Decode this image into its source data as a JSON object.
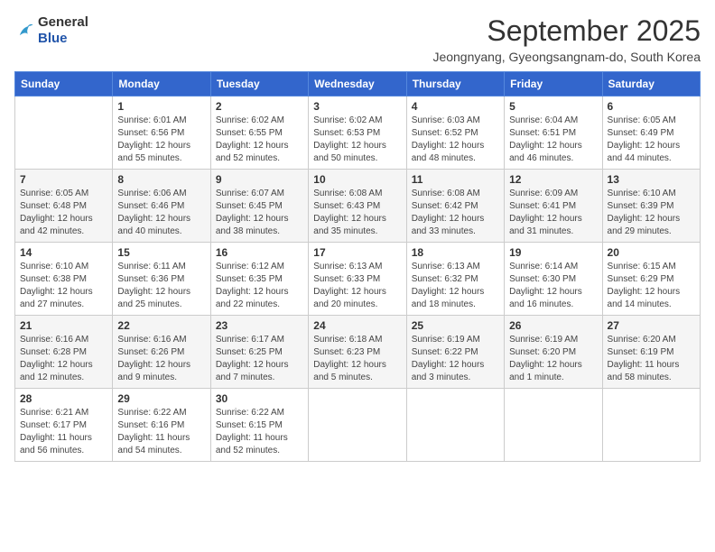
{
  "logo": {
    "general": "General",
    "blue": "Blue"
  },
  "title": "September 2025",
  "subtitle": "Jeongnyang, Gyeongsangnam-do, South Korea",
  "weekdays": [
    "Sunday",
    "Monday",
    "Tuesday",
    "Wednesday",
    "Thursday",
    "Friday",
    "Saturday"
  ],
  "weeks": [
    [
      {
        "day": "",
        "info": ""
      },
      {
        "day": "1",
        "info": "Sunrise: 6:01 AM\nSunset: 6:56 PM\nDaylight: 12 hours\nand 55 minutes."
      },
      {
        "day": "2",
        "info": "Sunrise: 6:02 AM\nSunset: 6:55 PM\nDaylight: 12 hours\nand 52 minutes."
      },
      {
        "day": "3",
        "info": "Sunrise: 6:02 AM\nSunset: 6:53 PM\nDaylight: 12 hours\nand 50 minutes."
      },
      {
        "day": "4",
        "info": "Sunrise: 6:03 AM\nSunset: 6:52 PM\nDaylight: 12 hours\nand 48 minutes."
      },
      {
        "day": "5",
        "info": "Sunrise: 6:04 AM\nSunset: 6:51 PM\nDaylight: 12 hours\nand 46 minutes."
      },
      {
        "day": "6",
        "info": "Sunrise: 6:05 AM\nSunset: 6:49 PM\nDaylight: 12 hours\nand 44 minutes."
      }
    ],
    [
      {
        "day": "7",
        "info": "Sunrise: 6:05 AM\nSunset: 6:48 PM\nDaylight: 12 hours\nand 42 minutes."
      },
      {
        "day": "8",
        "info": "Sunrise: 6:06 AM\nSunset: 6:46 PM\nDaylight: 12 hours\nand 40 minutes."
      },
      {
        "day": "9",
        "info": "Sunrise: 6:07 AM\nSunset: 6:45 PM\nDaylight: 12 hours\nand 38 minutes."
      },
      {
        "day": "10",
        "info": "Sunrise: 6:08 AM\nSunset: 6:43 PM\nDaylight: 12 hours\nand 35 minutes."
      },
      {
        "day": "11",
        "info": "Sunrise: 6:08 AM\nSunset: 6:42 PM\nDaylight: 12 hours\nand 33 minutes."
      },
      {
        "day": "12",
        "info": "Sunrise: 6:09 AM\nSunset: 6:41 PM\nDaylight: 12 hours\nand 31 minutes."
      },
      {
        "day": "13",
        "info": "Sunrise: 6:10 AM\nSunset: 6:39 PM\nDaylight: 12 hours\nand 29 minutes."
      }
    ],
    [
      {
        "day": "14",
        "info": "Sunrise: 6:10 AM\nSunset: 6:38 PM\nDaylight: 12 hours\nand 27 minutes."
      },
      {
        "day": "15",
        "info": "Sunrise: 6:11 AM\nSunset: 6:36 PM\nDaylight: 12 hours\nand 25 minutes."
      },
      {
        "day": "16",
        "info": "Sunrise: 6:12 AM\nSunset: 6:35 PM\nDaylight: 12 hours\nand 22 minutes."
      },
      {
        "day": "17",
        "info": "Sunrise: 6:13 AM\nSunset: 6:33 PM\nDaylight: 12 hours\nand 20 minutes."
      },
      {
        "day": "18",
        "info": "Sunrise: 6:13 AM\nSunset: 6:32 PM\nDaylight: 12 hours\nand 18 minutes."
      },
      {
        "day": "19",
        "info": "Sunrise: 6:14 AM\nSunset: 6:30 PM\nDaylight: 12 hours\nand 16 minutes."
      },
      {
        "day": "20",
        "info": "Sunrise: 6:15 AM\nSunset: 6:29 PM\nDaylight: 12 hours\nand 14 minutes."
      }
    ],
    [
      {
        "day": "21",
        "info": "Sunrise: 6:16 AM\nSunset: 6:28 PM\nDaylight: 12 hours\nand 12 minutes."
      },
      {
        "day": "22",
        "info": "Sunrise: 6:16 AM\nSunset: 6:26 PM\nDaylight: 12 hours\nand 9 minutes."
      },
      {
        "day": "23",
        "info": "Sunrise: 6:17 AM\nSunset: 6:25 PM\nDaylight: 12 hours\nand 7 minutes."
      },
      {
        "day": "24",
        "info": "Sunrise: 6:18 AM\nSunset: 6:23 PM\nDaylight: 12 hours\nand 5 minutes."
      },
      {
        "day": "25",
        "info": "Sunrise: 6:19 AM\nSunset: 6:22 PM\nDaylight: 12 hours\nand 3 minutes."
      },
      {
        "day": "26",
        "info": "Sunrise: 6:19 AM\nSunset: 6:20 PM\nDaylight: 12 hours\nand 1 minute."
      },
      {
        "day": "27",
        "info": "Sunrise: 6:20 AM\nSunset: 6:19 PM\nDaylight: 11 hours\nand 58 minutes."
      }
    ],
    [
      {
        "day": "28",
        "info": "Sunrise: 6:21 AM\nSunset: 6:17 PM\nDaylight: 11 hours\nand 56 minutes."
      },
      {
        "day": "29",
        "info": "Sunrise: 6:22 AM\nSunset: 6:16 PM\nDaylight: 11 hours\nand 54 minutes."
      },
      {
        "day": "30",
        "info": "Sunrise: 6:22 AM\nSunset: 6:15 PM\nDaylight: 11 hours\nand 52 minutes."
      },
      {
        "day": "",
        "info": ""
      },
      {
        "day": "",
        "info": ""
      },
      {
        "day": "",
        "info": ""
      },
      {
        "day": "",
        "info": ""
      }
    ]
  ]
}
